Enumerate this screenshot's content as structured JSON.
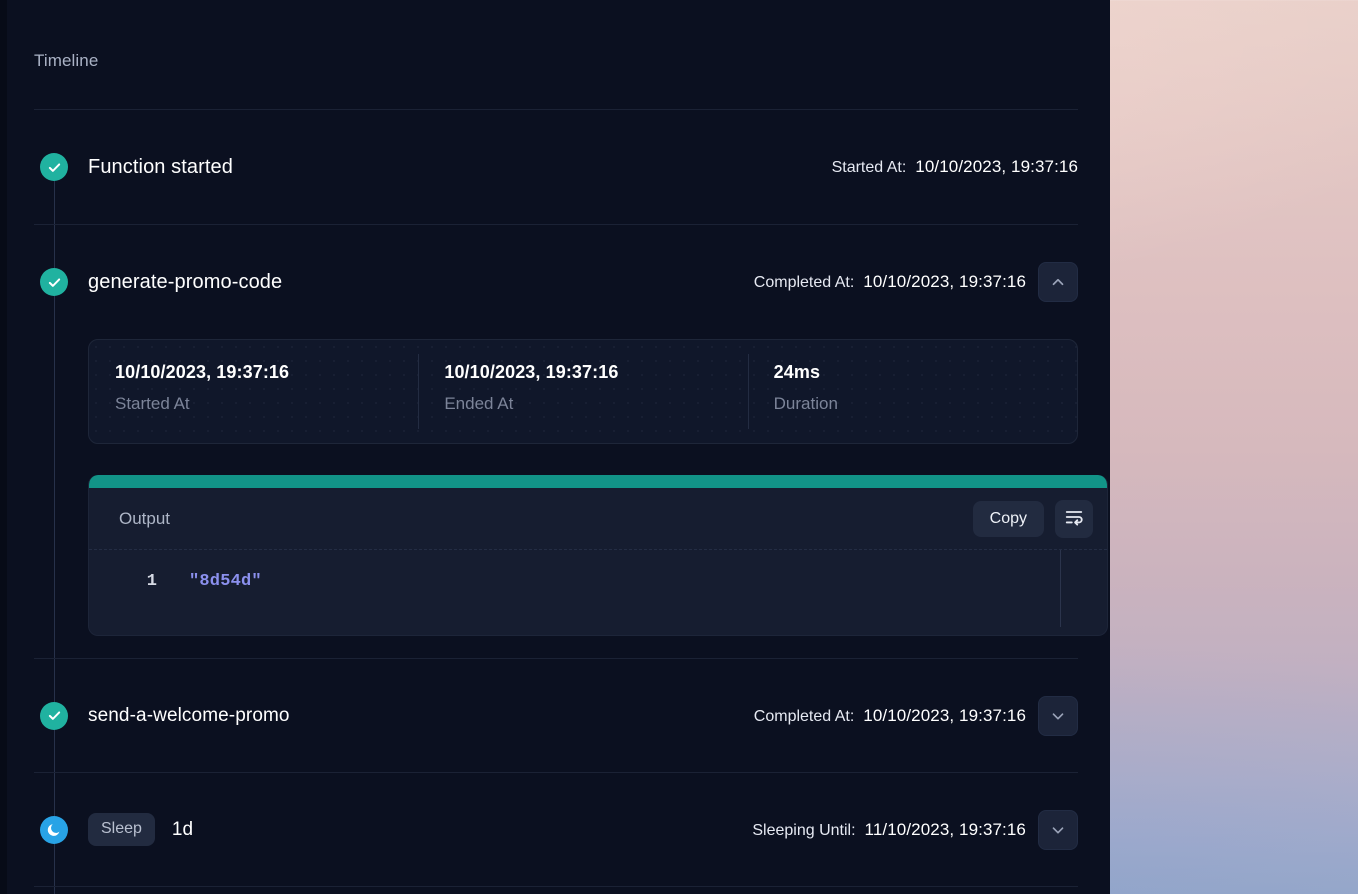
{
  "window": {
    "panel_bg": "#0b1020",
    "accent_teal": "#20b2a0",
    "accent_blue": "#28a3e6",
    "code_accent": "#129488",
    "string_color": "#8b90ee"
  },
  "timeline": {
    "title": "Timeline",
    "rows": [
      {
        "id": "function-started",
        "icon": "check-circle-icon",
        "label": "Function started",
        "meta_key": "Started At:",
        "meta_value": "10/10/2023, 19:37:16",
        "has_toggle": false
      },
      {
        "id": "generate-promo-code",
        "icon": "check-circle-icon",
        "label": "generate-promo-code",
        "meta_key": "Completed At:",
        "meta_value": "10/10/2023, 19:37:16",
        "has_toggle": true,
        "toggle_icon": "chevron-up-icon",
        "expanded": true,
        "stats": [
          {
            "value": "10/10/2023, 19:37:16",
            "label": "Started At"
          },
          {
            "value": "10/10/2023, 19:37:16",
            "label": "Ended At"
          },
          {
            "value": "24ms",
            "label": "Duration"
          }
        ],
        "output": {
          "title": "Output",
          "copy_label": "Copy",
          "wrap_icon": "text-wrap-icon",
          "lines": [
            {
              "number": "1",
              "code": "\"8d54d\""
            }
          ]
        }
      },
      {
        "id": "send-a-welcome-promo",
        "icon": "check-circle-icon",
        "label": "send-a-welcome-promo",
        "meta_key": "Completed At:",
        "meta_value": "10/10/2023, 19:37:16",
        "has_toggle": true,
        "toggle_icon": "chevron-down-icon",
        "expanded": false
      },
      {
        "id": "sleep",
        "icon": "moon-icon",
        "badge": "Sleep",
        "label": "1d",
        "meta_key": "Sleeping Until:",
        "meta_value": "11/10/2023, 19:37:16",
        "has_toggle": true,
        "toggle_icon": "chevron-down-icon",
        "expanded": false
      }
    ]
  }
}
